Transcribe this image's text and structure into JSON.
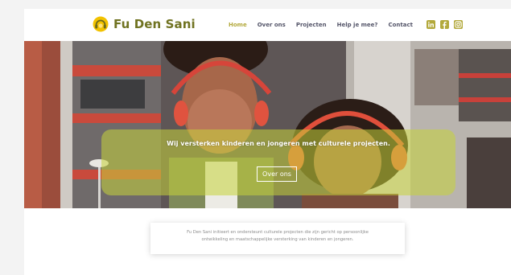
{
  "brand": {
    "name": "Fu Den Sani",
    "color": "#707321"
  },
  "nav": {
    "items": [
      {
        "label": "Home",
        "active": true
      },
      {
        "label": "Over ons",
        "active": false
      },
      {
        "label": "Projecten",
        "active": false
      },
      {
        "label": "Help je mee?",
        "active": false
      },
      {
        "label": "Contact",
        "active": false
      }
    ],
    "active_color": "#b3a93c"
  },
  "social": {
    "icons": [
      "linkedin-icon",
      "facebook-icon",
      "instagram-icon"
    ],
    "color": "#b3a93c"
  },
  "hero": {
    "title": "Wij versterken kinderen en jongeren met culturele projecten.",
    "button_label": "Over ons",
    "overlay_color": "#c7d33a"
  },
  "intro": {
    "line1": "Fu Den Sani initieert en ondersteunt culturele projecten die zijn gericht op persoonlijke",
    "line2": "ontwikkeling en maatschappelijke versterking van kinderen en jongeren."
  }
}
